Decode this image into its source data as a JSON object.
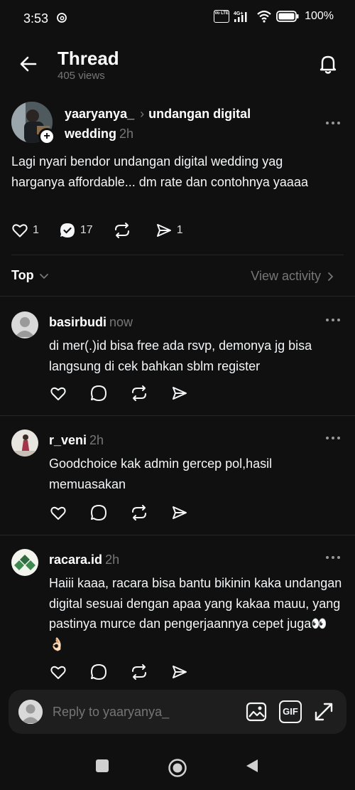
{
  "status_bar": {
    "time": "3:53",
    "volte_label": "Vo LTE",
    "network": "4G+",
    "battery": "100%"
  },
  "header": {
    "title": "Thread",
    "views": "405 views"
  },
  "post": {
    "author": "yaaryanya_",
    "topic": "undangan digital wedding",
    "time": "2h",
    "text": "Lagi nyari bendor undangan digital wedding yag harganya affordable... dm rate dan contohnya yaaaa",
    "likes": "1",
    "replies": "17",
    "shares": "1"
  },
  "sort": {
    "label": "Top",
    "view_activity": "View activity"
  },
  "replies": [
    {
      "username": "basirbudi",
      "time": "now",
      "text": "di mer(.)id bisa free ada rsvp, demonya jg bisa langsung di cek bahkan sblm register"
    },
    {
      "username": "r_veni",
      "time": "2h",
      "text": "Goodchoice kak admin gercep pol,hasil memuasakan"
    },
    {
      "username": "racara.id",
      "time": "2h",
      "text": "Haiii kaaa, racara bisa bantu bikinin kaka undangan digital sesuai dengan apaa yang kakaa mauu, yang pastinya murce dan pengerjaannya cepet juga👀 👌🏻"
    }
  ],
  "composer": {
    "placeholder": "Reply to yaaryanya_",
    "gif_label": "GIF"
  },
  "icons": {
    "back": "arrow-left-icon",
    "bell": "bell-icon",
    "like": "heart-icon",
    "reply": "comment-icon",
    "repost": "repost-icon",
    "share": "send-icon"
  }
}
